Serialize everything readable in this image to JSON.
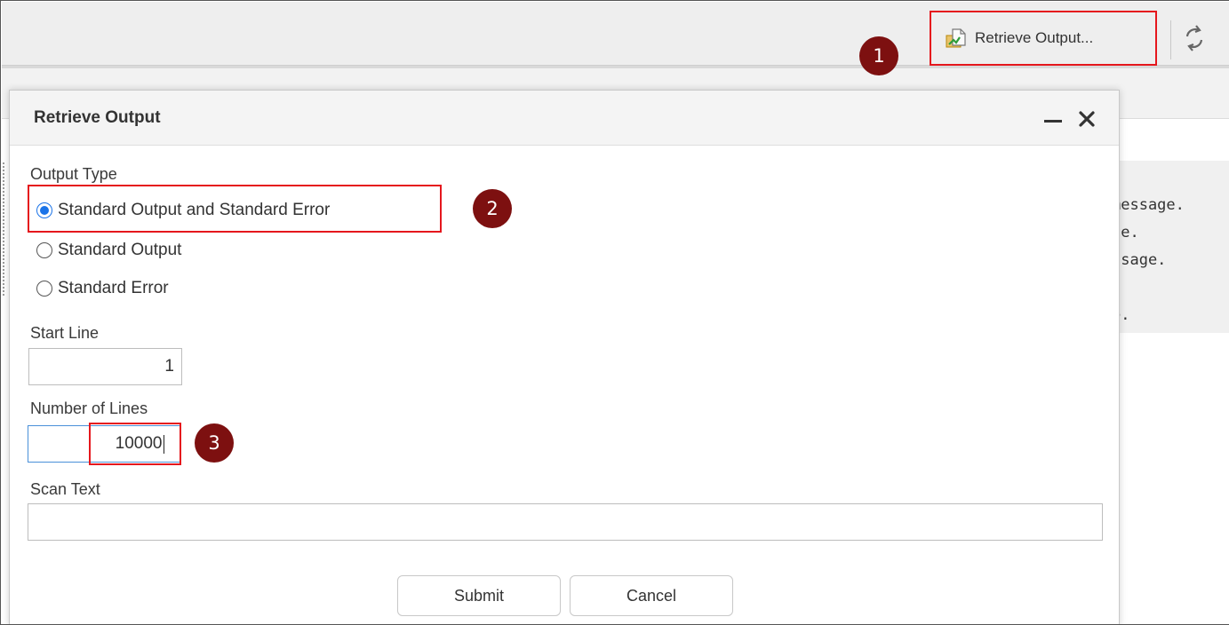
{
  "toolbar": {
    "retrieve_label": "Retrieve Output...",
    "retrieve_icon": "file-export-icon",
    "refresh_icon": "refresh-icon"
  },
  "console_lines": [
    "message.",
    "ge.",
    "ssage.",
    ".",
    "e."
  ],
  "dialog": {
    "title": "Retrieve Output",
    "minimize_icon": "minimize-icon",
    "close_icon": "close-icon",
    "output_type_label": "Output Type",
    "options": [
      {
        "label": "Standard Output and Standard Error",
        "selected": true
      },
      {
        "label": "Standard Output",
        "selected": false
      },
      {
        "label": "Standard Error",
        "selected": false
      }
    ],
    "start_line_label": "Start Line",
    "start_line_value": "1",
    "num_lines_label": "Number of Lines",
    "num_lines_value": "10000",
    "scan_text_label": "Scan Text",
    "scan_text_value": "",
    "submit_label": "Submit",
    "cancel_label": "Cancel"
  },
  "annotations": {
    "step1": "1",
    "step2": "2",
    "step3": "3",
    "badge_color": "#7d1010",
    "highlight_color": "#e5171d"
  }
}
